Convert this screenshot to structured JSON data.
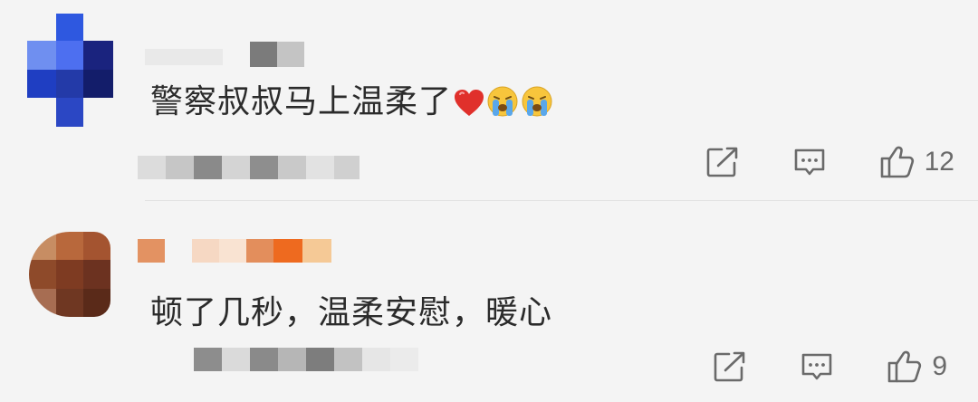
{
  "comments": [
    {
      "text": "警察叔叔马上温柔了",
      "emojis": [
        "red-heart",
        "crying-face",
        "crying-face"
      ],
      "like_count": "12",
      "avatar_colors": [
        "#4d86e8",
        "#1f3ec2",
        "#131d6a"
      ]
    },
    {
      "text": "顿了几秒，温柔安慰，暖心",
      "emojis": [],
      "like_count": "9",
      "avatar_colors": [
        "#b8683c",
        "#7e3b22",
        "#5a2a19"
      ]
    }
  ],
  "icons": {
    "share": "share-icon",
    "reply": "comment-icon",
    "like": "thumbs-up-icon"
  },
  "colors": {
    "background": "#f4f4f4",
    "text": "#2b2b2b",
    "icon": "#6a6a6a",
    "heart": "#e0302b",
    "emoji_face": "#f7c53c",
    "emoji_tears": "#5aa7ea"
  }
}
